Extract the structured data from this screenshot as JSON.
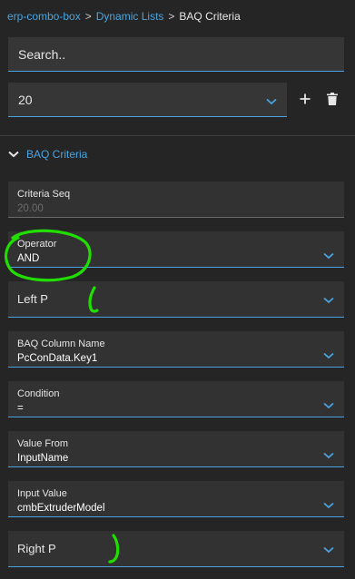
{
  "breadcrumb": {
    "items": [
      "erp-combo-box",
      "Dynamic Lists"
    ],
    "separator": ">",
    "current": "BAQ Criteria"
  },
  "search": {
    "placeholder": "Search.."
  },
  "record_selector": {
    "value": "20"
  },
  "section": {
    "title": "BAQ Criteria"
  },
  "fields": {
    "criteria_seq": {
      "label": "Criteria Seq",
      "value": "20.00"
    },
    "operator": {
      "label": "Operator",
      "value": "AND"
    },
    "left_p": {
      "placeholder": "Left P"
    },
    "baq_column_name": {
      "label": "BAQ Column Name",
      "value": "PcConData.Key1"
    },
    "condition": {
      "label": "Condition",
      "value": "="
    },
    "value_from": {
      "label": "Value From",
      "value": "InputName"
    },
    "input_value": {
      "label": "Input Value",
      "value": "cmbExtruderModel"
    },
    "right_p": {
      "placeholder": "Right P"
    }
  },
  "colors": {
    "accent": "#4aa3df",
    "background": "#252525",
    "field_bg": "#323232",
    "annotation": "#22dd00"
  },
  "icons": {
    "add": "plus-icon",
    "delete": "trash-icon",
    "dropdown": "chevron-down-icon",
    "expand": "chevron-down-icon"
  }
}
